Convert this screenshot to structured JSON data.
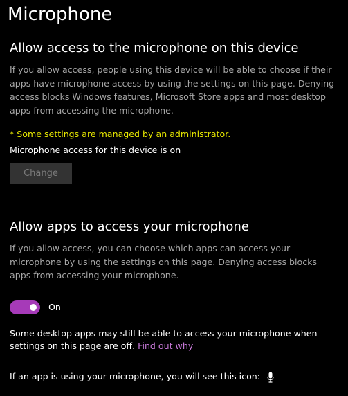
{
  "page": {
    "title": "Microphone"
  },
  "device_section": {
    "title": "Allow access to the microphone on this device",
    "description": "If you allow access, people using this device will be able to choose if their apps have microphone access by using the settings on this page. Denying access blocks Windows features, Microsoft Store apps and most desktop apps from accessing the microphone.",
    "admin_note": "* Some settings are managed by an administrator.",
    "status": "Microphone access for this device is on",
    "change_button": "Change"
  },
  "apps_section": {
    "title": "Allow apps to access your microphone",
    "description": "If you allow access, you can choose which apps can access your microphone by using the settings on this page. Denying access blocks apps from accessing your microphone.",
    "toggle_state": "On",
    "toggle_on": true,
    "desktop_note": "Some desktop apps may still be able to access your microphone when settings on this page are off.",
    "find_out_link": "Find out why",
    "icon_note": "If an app is using your microphone, you will see this icon:"
  },
  "colors": {
    "background": "#000000",
    "accent": "#a63ab8",
    "admin_note": "#e6e600",
    "link": "#c879d9",
    "secondary_text": "#a6a6a6"
  },
  "icons": {
    "in_use": "microphone-icon"
  }
}
